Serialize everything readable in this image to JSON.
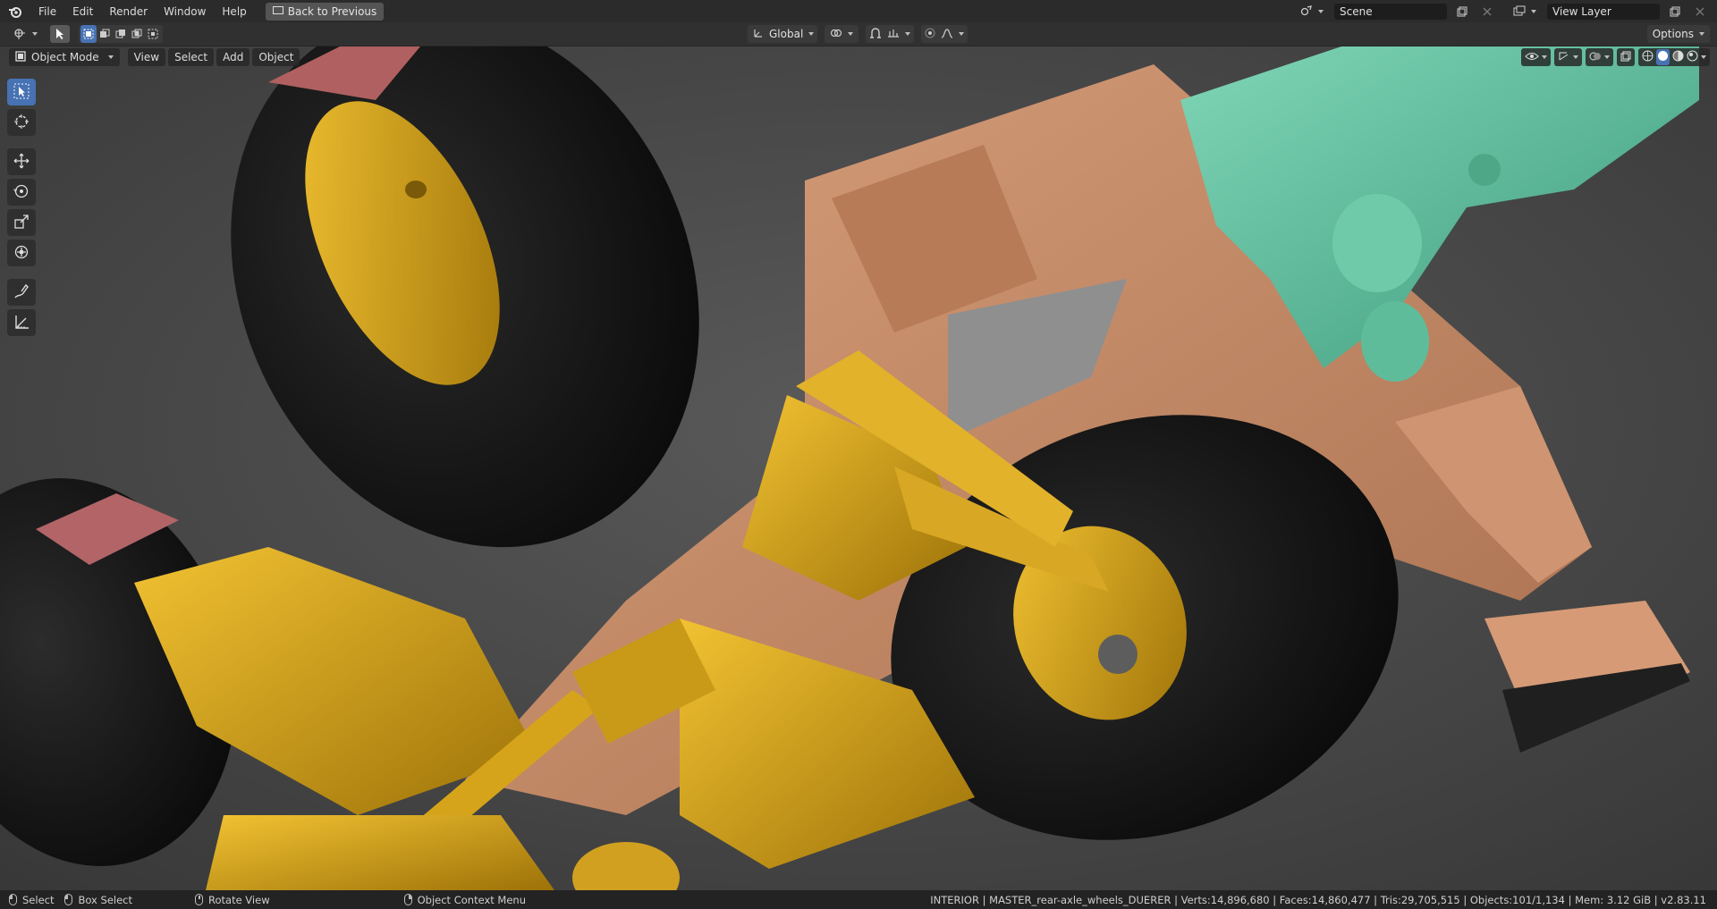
{
  "menu": {
    "items": [
      "File",
      "Edit",
      "Render",
      "Window",
      "Help"
    ],
    "back_button": "Back to Previous"
  },
  "scene": {
    "label": "Scene",
    "view_layer": "View Layer"
  },
  "tool_header": {
    "transform_orientation": "Global",
    "options": "Options"
  },
  "viewport_header": {
    "mode": "Object Mode",
    "menus": [
      "View",
      "Select",
      "Add",
      "Object"
    ]
  },
  "toolbar": {
    "tools": [
      "select-box-icon",
      "cursor-icon",
      "move-icon",
      "rotate-icon",
      "scale-icon",
      "transform-icon",
      "annotate-icon",
      "measure-icon"
    ]
  },
  "status": {
    "select": "Select",
    "box_select": "Box Select",
    "rotate_view": "Rotate View",
    "context_menu": "Object Context Menu",
    "stats": "INTERIOR | MASTER_rear-axle_wheels_DUERER | Verts:14,896,680 | Faces:14,860,477 | Tris:29,705,515 | Objects:101/1,134 | Mem: 3.12 GiB | v2.83.11"
  },
  "colors": {
    "accent": "#4772b3",
    "yellow_parts": "#d6a41a",
    "frame": "#c98d6b",
    "teal_parts": "#5bb99b",
    "tire": "#1a1a1a",
    "red_parts": "#b75a5e"
  }
}
